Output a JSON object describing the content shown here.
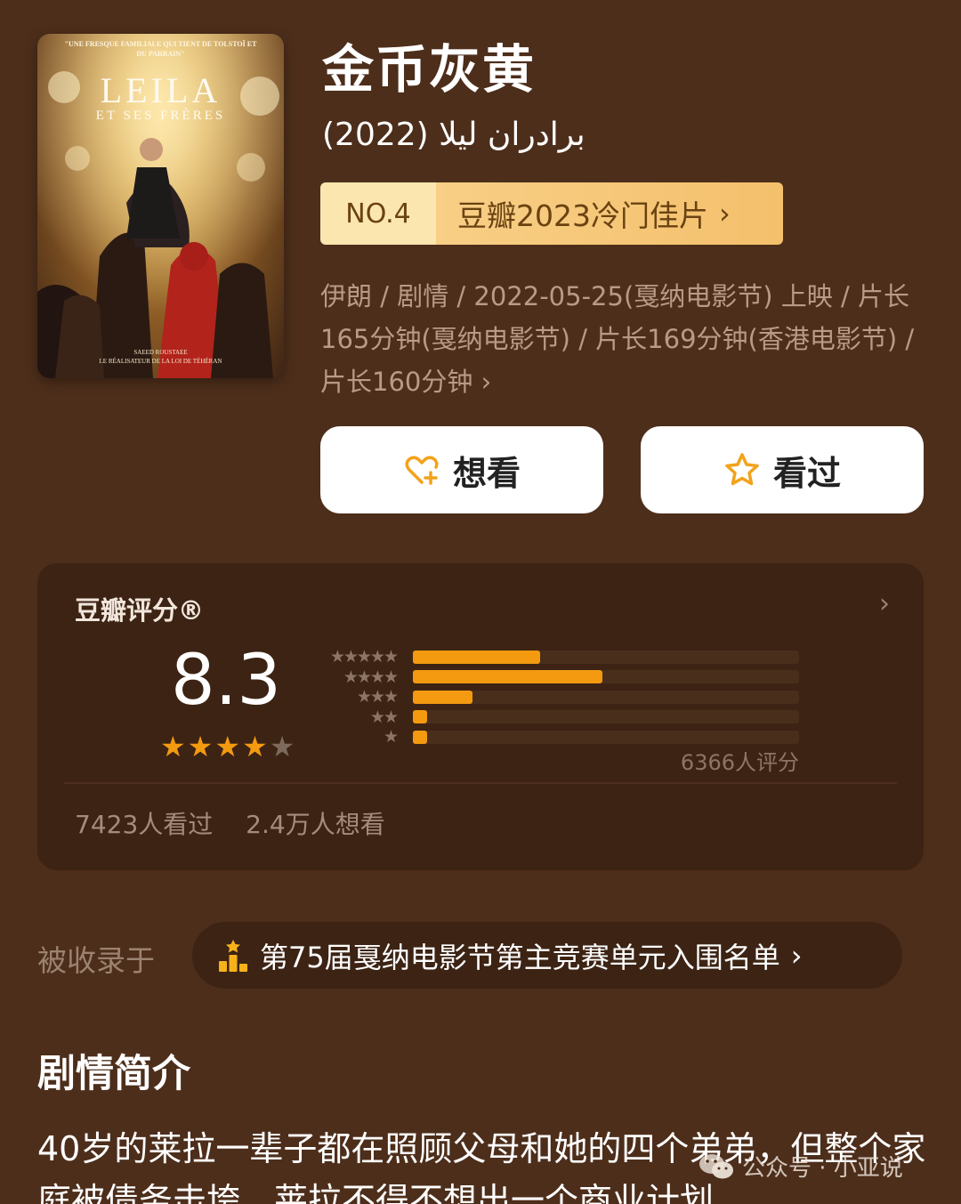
{
  "poster": {
    "tagline": "\"UNE FRESQUE FAMILIALE QUI TIENT DE TOLSTOÏ ET DU PARRAIN\"",
    "title": "LEILA",
    "subtitle": "ET SES FRÈRES",
    "credit_line1": "SAEED ROUSTAEE",
    "credit_line2": "LE RÉALISATEUR DE LA LOI DE TÉHÉRAN"
  },
  "movie": {
    "title": "金币灰黄",
    "original_title": "(2022) برادران لیلا",
    "rank_no": "NO.4",
    "rank_list": "豆瓣2023冷门佳片",
    "meta": "伊朗 / 剧情 / 2022-05-25(戛纳电影节) 上映 / 片长165分钟(戛纳电影节) / 片长169分钟(香港电影节) / 片长160分钟"
  },
  "actions": {
    "want_label": "想看",
    "seen_label": "看过"
  },
  "rating": {
    "label": "豆瓣评分®",
    "score": "8.3",
    "stars": 4,
    "star_max": 5,
    "distribution": [
      {
        "stars": "★★★★★",
        "fraction": 0.33
      },
      {
        "stars": "★★★★",
        "fraction": 0.49
      },
      {
        "stars": "★★★",
        "fraction": 0.155
      },
      {
        "stars": "★★",
        "fraction": 0.02
      },
      {
        "stars": "★",
        "fraction": 0.02
      }
    ],
    "count": "6366人评分",
    "seen": "7423人看过",
    "want": "2.4万人想看"
  },
  "collection": {
    "label": "被收录于",
    "name": "第75届戛纳电影节第主竞赛单元入围名单"
  },
  "synopsis": {
    "heading": "剧情简介",
    "text": "40岁的莱拉一辈子都在照顾父母和她的四个弟弟，但整个家庭被债务击垮，莱拉不得不想出一个商业计划"
  },
  "watermark": {
    "text": "公众号 · 小亚说"
  },
  "colors": {
    "background": "#4d2e1b",
    "card": "#3c2314",
    "accent": "#f39a10",
    "badge": "#f8cf86"
  }
}
